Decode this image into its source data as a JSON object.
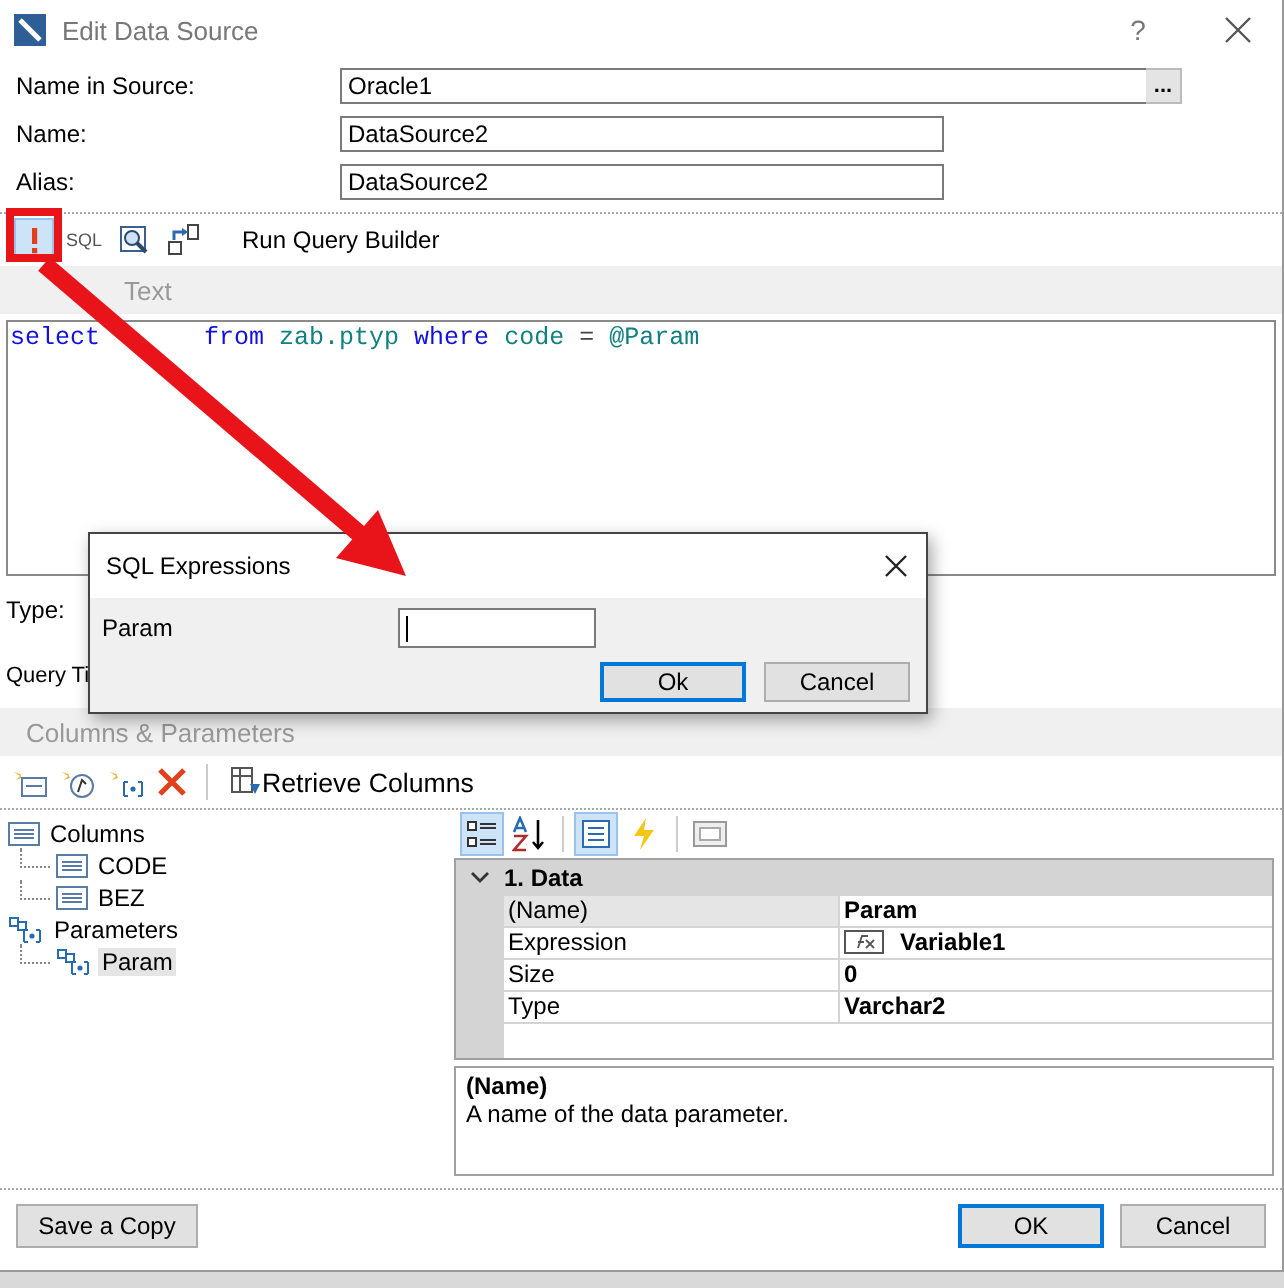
{
  "window": {
    "title": "Edit Data Source",
    "help": "?"
  },
  "fields": [
    {
      "label": "Name in Source:",
      "value": "Oracle1",
      "kind": "browse",
      "button": "..."
    },
    {
      "label": "Name:",
      "value": "DataSource2",
      "kind": "text"
    },
    {
      "label": "Alias:",
      "value": "DataSource2",
      "kind": "text"
    }
  ],
  "query_toolbar": {
    "buttons": [
      {
        "kind": "exclamation",
        "selected": true
      },
      {
        "kind": "sql",
        "label": "SQL",
        "selected": false
      },
      {
        "kind": "preview",
        "selected": false
      },
      {
        "kind": "builder",
        "selected": false
      }
    ],
    "run_query_builder": "Run Query Builder"
  },
  "query_text": {
    "header": "Text",
    "tokens": [
      {
        "text": "select",
        "kind": "keyword"
      },
      {
        "text": "from",
        "kind": "keyword"
      },
      {
        "text": "zab.ptyp",
        "kind": "identifier"
      },
      {
        "text": "where",
        "kind": "keyword"
      },
      {
        "text": "code",
        "kind": "identifier"
      },
      {
        "text": "=",
        "kind": "operator"
      },
      {
        "text": "@Param",
        "kind": "identifier"
      }
    ]
  },
  "type_label": "Type:",
  "timeout_label": "Query Ti",
  "columns_parameters": {
    "header": "Columns & Parameters",
    "retrieve_columns": "Retrieve Columns",
    "tree": [
      {
        "label": "Columns",
        "kind": "columns",
        "selected": false,
        "children": [
          {
            "label": "CODE",
            "kind": "column",
            "selected": false
          },
          {
            "label": "BEZ",
            "kind": "column",
            "selected": false
          }
        ]
      },
      {
        "label": "Parameters",
        "kind": "parameters",
        "selected": false,
        "children": [
          {
            "label": "Param",
            "kind": "parameter",
            "selected": true
          }
        ]
      }
    ]
  },
  "property_grid": {
    "toolbar": [
      {
        "kind": "categorized",
        "selected": true
      },
      {
        "kind": "alphabetical",
        "selected": false
      },
      {
        "kind": "properties",
        "selected": true
      },
      {
        "kind": "events",
        "selected": false
      },
      {
        "kind": "pages",
        "selected": false
      }
    ],
    "category": {
      "title": "1. Data",
      "expanded": true
    },
    "rows": [
      {
        "name": "(Name)",
        "value": "Param",
        "selected": true
      },
      {
        "name": "Expression",
        "value": "Variable1",
        "kind": "expression",
        "selected": false
      },
      {
        "name": "Size",
        "value": "0",
        "selected": false
      },
      {
        "name": "Type",
        "value": "Varchar2",
        "selected": false
      }
    ],
    "description": {
      "title": "(Name)",
      "text": "A name of the data parameter."
    }
  },
  "footer": {
    "save_copy": "Save a Copy",
    "ok": "OK",
    "cancel": "Cancel"
  },
  "popup": {
    "title": "SQL Expressions",
    "field_label": "Param",
    "ok": "Ok",
    "cancel": "Cancel"
  }
}
